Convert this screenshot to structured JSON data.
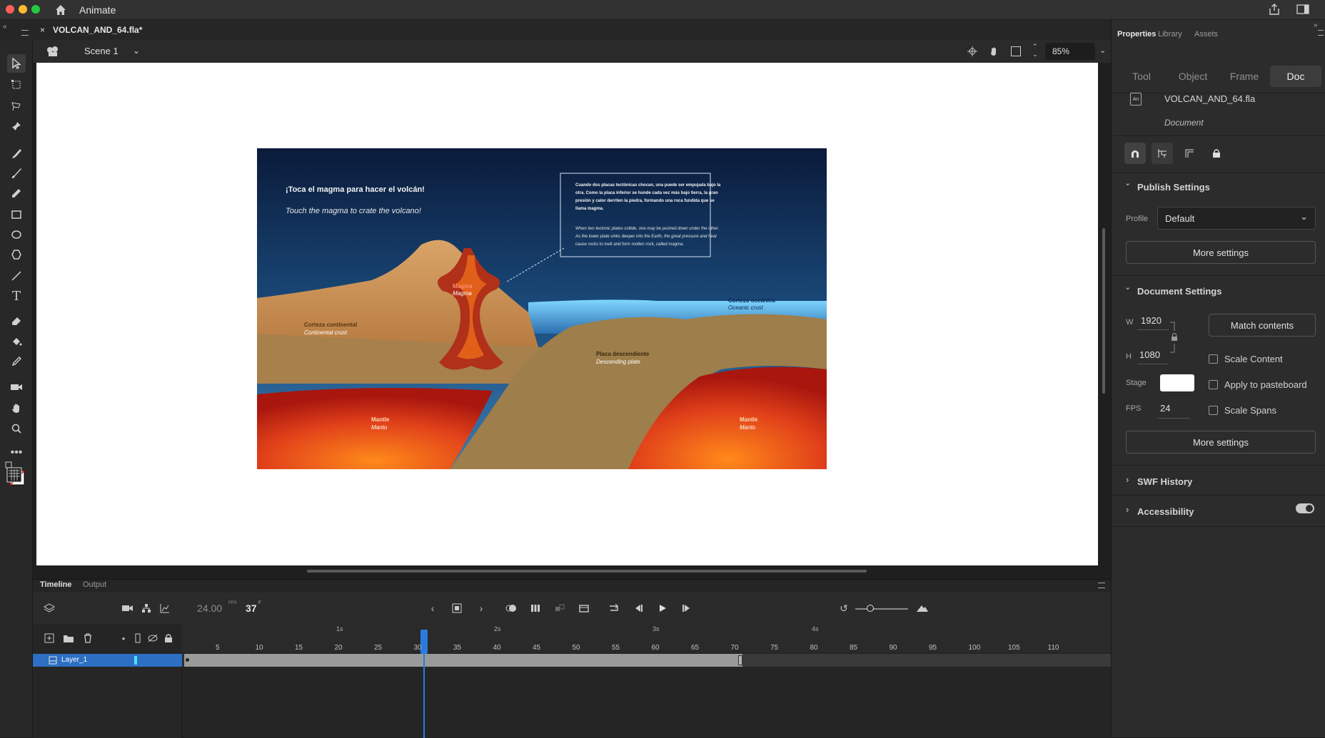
{
  "app": {
    "name": "Animate"
  },
  "document": {
    "tab_label": "VOLCAN_AND_64.fla*"
  },
  "editbar": {
    "scene": "Scene 1",
    "zoom": "85%"
  },
  "stage_content": {
    "heading_es": "¡Toca el magma para hacer el volcán!",
    "heading_en": "Touch the magma to crate the volcano!",
    "info_es": "Cuando dos placas tectónicas chocan, una puede ser empujada bajo la otra. Como la placa inferior se hunde cada vez más bajo tierra, la gran presión y calor derriten la piedra, formando una roca fundida que se llama magma.",
    "info_en": "When two tectonic plates collide, one may be pushed down under the other. As the lower plate sinks deeper into the Earth, the great pressure and heat cause rocks to melt and form molten rock, called magma.",
    "magma_es": "Magma",
    "magma_en": "Magma",
    "continental_es": "Corteza continental",
    "continental_en": "Continental crust",
    "oceanic_es": "Corteza oceánica",
    "oceanic_en": "Oceanic crust",
    "descending_es": "Placa descendiente",
    "descending_en": "Descending plate",
    "mantle_left_en": "Mantle",
    "mantle_left_es": "Manto",
    "mantle_right_en": "Mantle",
    "mantle_right_es": "Manto"
  },
  "timeline": {
    "tabs": [
      "Timeline",
      "Output"
    ],
    "fps": "24.00",
    "fps_unit": "FPS",
    "current_frame": "37",
    "frame_unit": "F",
    "layer_name": "Layer_1",
    "seconds_labels": [
      "1s",
      "2s",
      "3s",
      "4s"
    ],
    "frame_labels": [
      "5",
      "10",
      "15",
      "20",
      "25",
      "30",
      "35",
      "40",
      "45",
      "50",
      "55",
      "60",
      "65",
      "70",
      "75",
      "80",
      "85",
      "90",
      "95",
      "100",
      "105",
      "110"
    ]
  },
  "panel": {
    "tabs": [
      "Properties",
      "Library",
      "Assets"
    ],
    "subtabs": [
      "Tool",
      "Object",
      "Frame",
      "Doc"
    ],
    "active_subtab": "Doc",
    "file_name": "VOLCAN_AND_64.fla",
    "file_type": "Document",
    "publish_settings": {
      "title": "Publish Settings",
      "profile_label": "Profile",
      "profile_value": "Default",
      "more": "More settings"
    },
    "document_settings": {
      "title": "Document Settings",
      "w_label": "W",
      "w_value": "1920",
      "h_label": "H",
      "h_value": "1080",
      "match_contents": "Match contents",
      "scale_content": "Scale Content",
      "stage_label": "Stage",
      "apply_pasteboard": "Apply to pasteboard",
      "fps_label": "FPS",
      "fps_value": "24",
      "scale_spans": "Scale Spans",
      "more": "More settings"
    },
    "swf_history": "SWF History",
    "accessibility": "Accessibility"
  }
}
